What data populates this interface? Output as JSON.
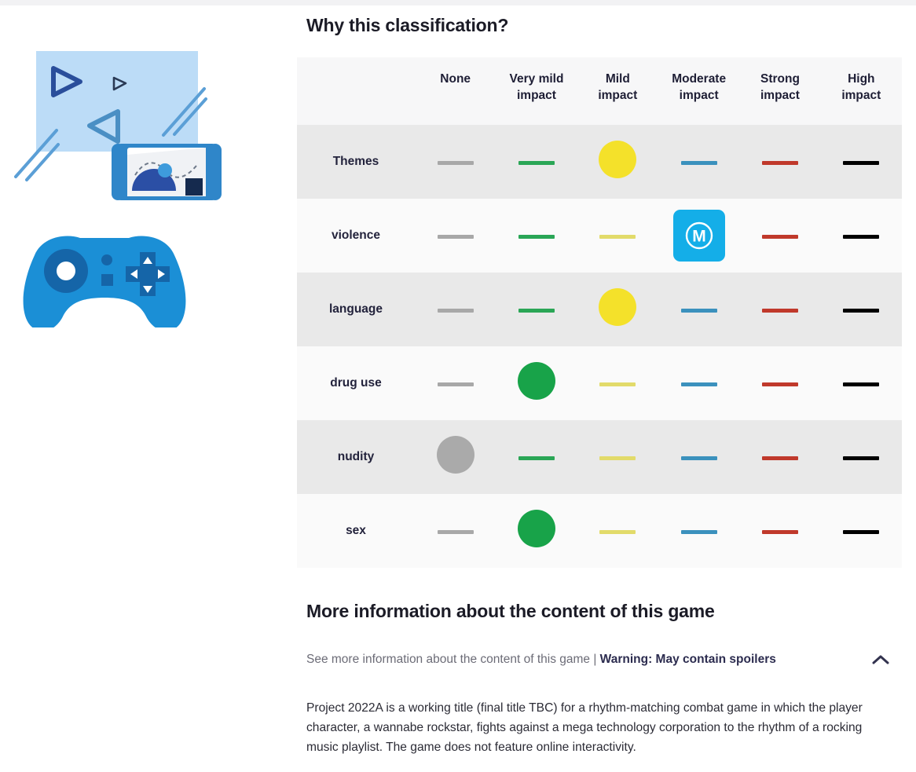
{
  "header": {
    "why_title": "Why this classification?"
  },
  "table": {
    "columns": [
      {
        "id": "none",
        "line1": "None",
        "line2": ""
      },
      {
        "id": "verymild",
        "line1": "Very mild",
        "line2": "impact"
      },
      {
        "id": "mild",
        "line1": "Mild",
        "line2": "impact"
      },
      {
        "id": "moderate",
        "line1": "Moderate",
        "line2": "impact"
      },
      {
        "id": "strong",
        "line1": "Strong",
        "line2": "impact"
      },
      {
        "id": "high",
        "line1": "High",
        "line2": "impact"
      }
    ],
    "rows": [
      {
        "label": "Themes",
        "selected": "mild",
        "marker": "dot-yellow"
      },
      {
        "label": "violence",
        "selected": "moderate",
        "marker": "badge-m"
      },
      {
        "label": "language",
        "selected": "mild",
        "marker": "dot-yellow"
      },
      {
        "label": "drug use",
        "selected": "verymild",
        "marker": "dot-green"
      },
      {
        "label": "nudity",
        "selected": "none",
        "marker": "dot-gray"
      },
      {
        "label": "sex",
        "selected": "verymild",
        "marker": "dot-green"
      }
    ]
  },
  "badge": {
    "letter": "M"
  },
  "more_info": {
    "title": "More information about the content of this game",
    "spoiler_prefix": "See more information about the content of this game | ",
    "spoiler_warning": "Warning: May contain spoilers",
    "description": "Project 2022A is a working title (final title TBC) for a rhythm-matching combat game in which the player character, a wannabe rockstar, fights against a mega technology corporation to the rhythm of a rocking music playlist. The game does not feature online interactivity."
  },
  "colors": {
    "none": "#a8a8a8",
    "very_mild": "#2aa656",
    "mild": "#e2db6a",
    "moderate": "#3b91bd",
    "strong": "#c0392b",
    "high": "#000000",
    "badge_bg": "#14aee8",
    "dot_mild": "#f4e12a",
    "dot_very_mild": "#18a349",
    "dot_none": "#aaaaaa"
  }
}
